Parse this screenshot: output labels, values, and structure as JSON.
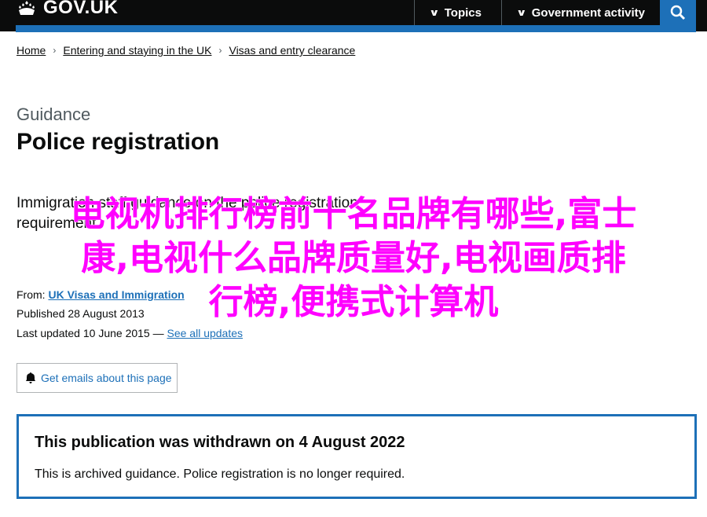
{
  "header": {
    "logo_text": "GOV.UK",
    "topics_label": "Topics",
    "gov_activity_label": "Government activity",
    "colors": {
      "header_bg": "#0b0c0c",
      "accent": "#1d70b8"
    }
  },
  "breadcrumb": {
    "items": [
      "Home",
      "Entering and staying in the UK",
      "Visas and entry clearance"
    ]
  },
  "page": {
    "caption": "Guidance",
    "title": "Police registration",
    "summary": "Immigration staff guidance on the police registration requirement."
  },
  "meta": {
    "from_label": "From:",
    "from_org": "UK Visas and Immigration",
    "published_label": "Published",
    "published_date": "28 August 2013",
    "updated_label": "Last updated",
    "updated_date": "10 June 2015",
    "updates_sep": "—",
    "see_all_updates": "See all updates"
  },
  "email_button": {
    "label": "Get emails about this page"
  },
  "withdrawn": {
    "heading": "This publication was withdrawn on 4 August 2022",
    "body": "This is archived guidance. Police registration is no longer required."
  },
  "overlay": {
    "line1": "电视机排行榜前十名品牌有哪些,富士",
    "line2": "康,电视什么品牌质量好,电视画质排",
    "line3": "行榜,便携式计算机",
    "color": "#ff00ff"
  }
}
